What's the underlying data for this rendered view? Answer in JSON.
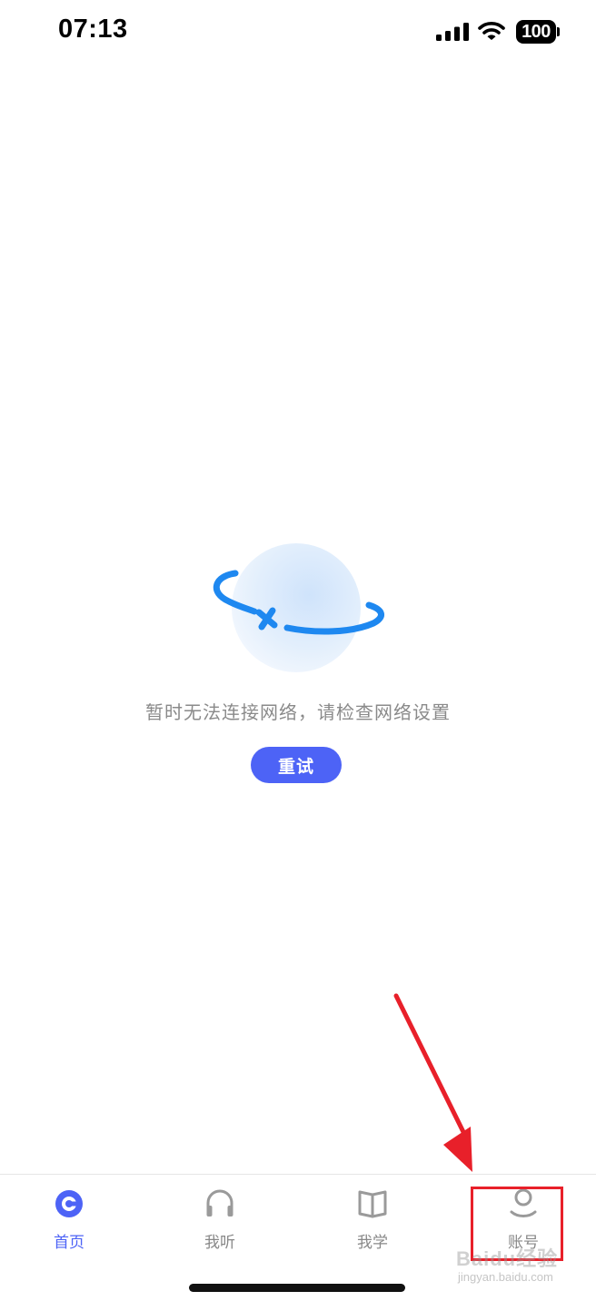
{
  "status_bar": {
    "time": "07:13",
    "battery_level": "100",
    "icons": [
      "signal-icon",
      "wifi-icon",
      "battery-icon"
    ]
  },
  "error_state": {
    "illustration": "disconnected-planet-icon",
    "message": "暂时无法连接网络，请检查网络设置",
    "retry_label": "重试"
  },
  "tab_bar": {
    "active_tab": "home",
    "tabs": [
      {
        "id": "home",
        "label": "首页",
        "icon": "home-icon"
      },
      {
        "id": "listen",
        "label": "我听",
        "icon": "headphones-icon"
      },
      {
        "id": "learn",
        "label": "我学",
        "icon": "book-icon"
      },
      {
        "id": "account",
        "label": "账号",
        "icon": "user-icon"
      }
    ]
  },
  "watermark": {
    "brand": "Baidu经验",
    "url": "jingyan.baidu.com"
  },
  "colors": {
    "accent": "#4d63f6",
    "illustration_blue": "#1e88f0",
    "annotation_red": "#e8202a",
    "inactive_text": "#888888"
  }
}
